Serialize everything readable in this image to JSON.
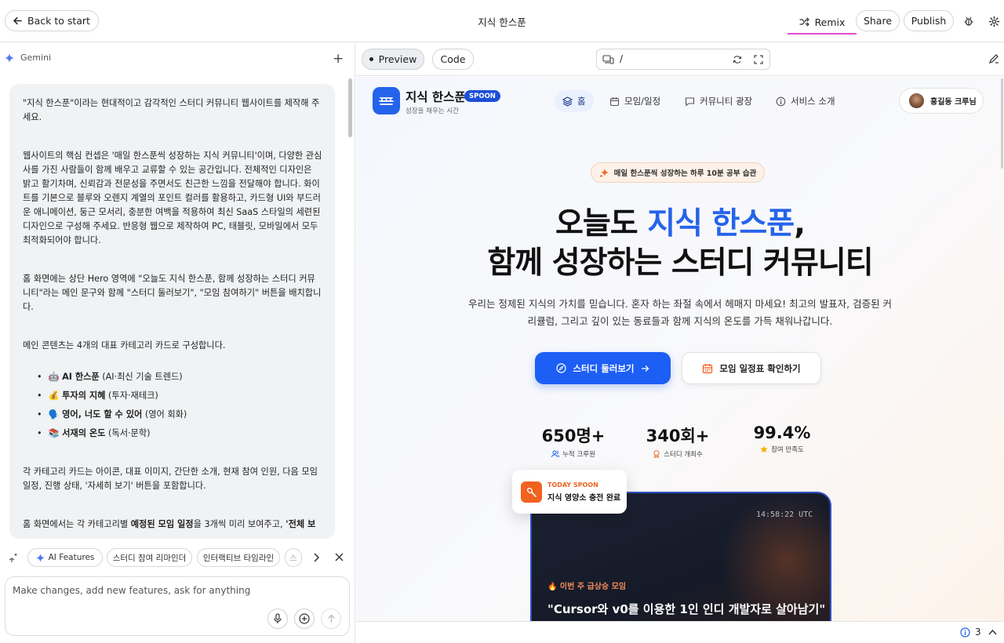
{
  "topbar": {
    "back_label": "Back to start",
    "title": "지식 한스푼",
    "remix_label": "Remix",
    "share_label": "Share",
    "publish_label": "Publish",
    "accent_color": "#e64bd3"
  },
  "chat": {
    "assistant_name": "Gemini",
    "prompt_paragraphs": [
      "\"지식 한스푼\"이라는 현대적이고 감각적인 스터디 커뮤니티 웹사이트를 제작해 주세요.",
      "웹사이트의 핵심 컨셉은 '매일 한스푼씩 성장하는 지식 커뮤니티'이며, 다양한 관심사를 가진 사람들이 함께 배우고 교류할 수 있는 공간입니다. 전체적인 디자인은 밝고 활기차며, 신뢰감과 전문성을 주면서도 친근한 느낌을 전달해야 합니다. 화이트를 기본으로 블루와 오렌지 계열의 포인트 컬러를 활용하고, 카드형 UI와 부드러운 애니메이션, 둥근 모서리, 충분한 여백을 적용하여 최신 SaaS 스타일의 세련된 디자인으로 구성해 주세요. 반응형 웹으로 제작하여 PC, 태블릿, 모바일에서 모두 최적화되어야 합니다.",
      "홈 화면에는 상단 Hero 영역에 \"오늘도 지식 한스푼, 함께 성장하는 스터디 커뮤니티\"라는 메인 문구와 함께 \"스터디 둘러보기\", \"모임 참여하기\" 버튼을 배치합니다.",
      "메인 콘텐츠는 4개의 대표 카테고리 카드로 구성합니다."
    ],
    "categories": [
      {
        "emoji": "🤖",
        "name": "AI 한스푼",
        "desc": "(AI·최신 기술 트렌드)"
      },
      {
        "emoji": "💰",
        "name": "투자의 지혜",
        "desc": "(투자·재테크)"
      },
      {
        "emoji": "🗣️",
        "name": "영어, 너도 할 수 있어",
        "desc": "(영어 회화)"
      },
      {
        "emoji": "📚",
        "name": "서재의 온도",
        "desc": "(독서·문학)"
      }
    ],
    "paragraph_after": "각 카테고리 카드는 아이콘, 대표 이미지, 간단한 소개, 현재 참여 인원, 다음 모임 일정, 진행 상태, '자세히 보기' 버튼을 포함합니다.",
    "paragraph_last_pre": "홈 화면에서는 각 카테고리별 ",
    "paragraph_last_bold": "예정된 모임 일정",
    "paragraph_last_mid": "을 3개씩 미리 보여주고, ",
    "paragraph_last_bold2": "'전체 보",
    "chips": [
      "AI Features",
      "스터디 참여 리마인더",
      "인터랙티브 타임라인",
      "스"
    ],
    "input_placeholder": "Make changes, add new features, ask for anything"
  },
  "preview_toolbar": {
    "preview_label": "Preview",
    "code_label": "Code",
    "url": "/"
  },
  "site": {
    "brand": "지식 한스푼",
    "badge": "SPOON",
    "tagline": "성장을 채우는 시간",
    "nav": [
      "홈",
      "모임/일정",
      "커뮤니티 광장",
      "서비스 소개"
    ],
    "user_name": "홍길동 크루님",
    "hero_tag": "매일 한스푼씩 성장하는 하루 10분 공부 습관",
    "hero_line1_pre": "오늘도 ",
    "hero_line1_highlight": "지식 한스푼",
    "hero_line1_post": ",",
    "hero_line2": "함께 성장하는 스터디 커뮤니티",
    "hero_desc": "우리는 정제된 지식의 가치를 믿습니다. 혼자 하는 좌절 속에서 헤매지 마세요! 최고의 발표자, 검증된 커리큘럼, 그리고 깊이 있는 동료들과 함께 지식의 온도를 가득 채워나갑니다.",
    "cta_primary": "스터디 둘러보기",
    "cta_secondary": "모임 일정표 확인하기",
    "stats": [
      {
        "value": "650명+",
        "label": "누적 크루원"
      },
      {
        "value": "340회+",
        "label": "스터디 개최수"
      },
      {
        "value": "99.4%",
        "label": "참여 만족도"
      }
    ],
    "toast_label": "TODAY SPOON",
    "toast_text": "지식 영양소 충전 완료",
    "card_time": "14:58:22 UTC",
    "card_tag": "🔥 이번 주 급상승 모임",
    "card_title": "\"Cursor와 v0를 이용한 1인 인디 개발자로 살아남기\"",
    "primary_color": "#2563eb",
    "accent_color": "#f2621f"
  },
  "status": {
    "issue_count": "3"
  }
}
